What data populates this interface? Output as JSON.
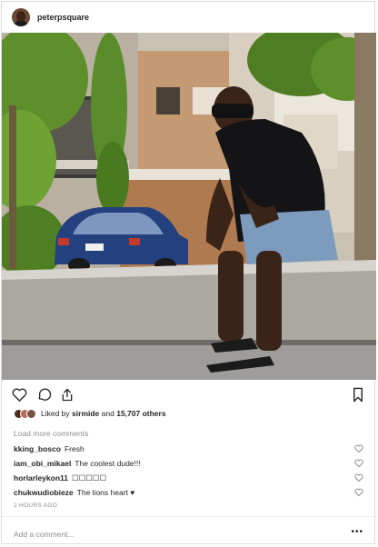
{
  "post": {
    "username": "peterpsquare"
  },
  "likes": {
    "prefix": "Liked by",
    "first_user": "sirmide",
    "middle": "and",
    "count_text": "15,707 others"
  },
  "load_more": "Load more comments",
  "comments": [
    {
      "user": "kking_bosco",
      "text": "Fresh"
    },
    {
      "user": "iam_obi_mikael",
      "text": "The coolest dude!!!"
    },
    {
      "user": "horlarleykon11",
      "text": "☐☐☐☐☐"
    },
    {
      "user": "chukwudiobieze",
      "text": "The lions heart ♥"
    }
  ],
  "timestamp": "2 HOURS AGO",
  "add_comment_placeholder": "Add a comment...",
  "more_label": "•••",
  "icons": {
    "like": "heart-icon",
    "comment": "comment-icon",
    "share": "share-icon",
    "save": "bookmark-icon",
    "comment_like": "heart-icon",
    "more": "more-options-icon"
  }
}
